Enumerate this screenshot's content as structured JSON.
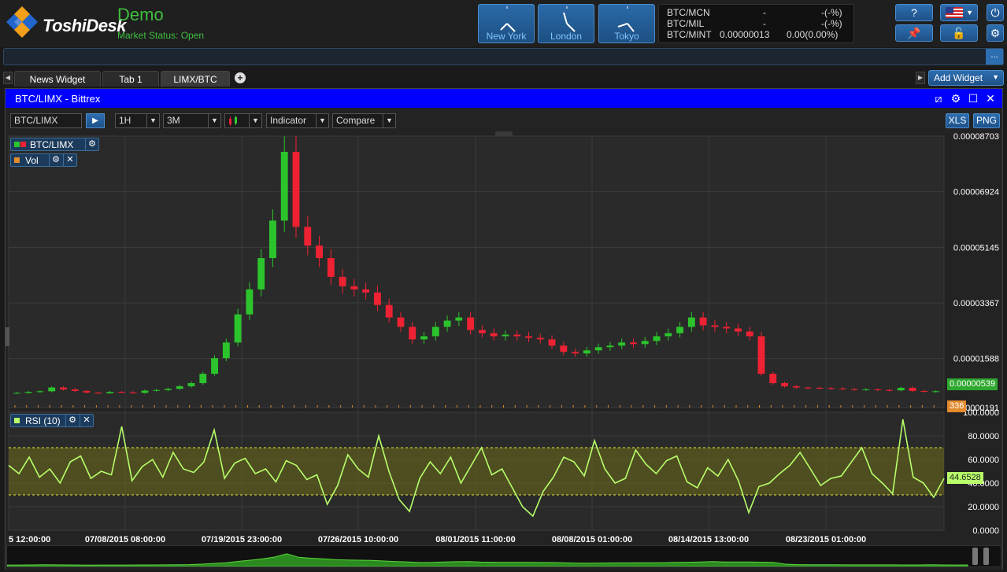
{
  "app": {
    "brand": "ToshiDesk",
    "mode": "Demo",
    "market_status": "Market Status: Open"
  },
  "clocks": [
    {
      "city": "New York"
    },
    {
      "city": "London"
    },
    {
      "city": "Tokyo"
    }
  ],
  "tickers": [
    {
      "symbol": "BTC/MCN",
      "price": "-",
      "change": "-(-%)"
    },
    {
      "symbol": "BTC/MIL",
      "price": "-",
      "change": "-(-%)"
    },
    {
      "symbol": "BTC/MINT",
      "price": "0.00000013",
      "change": "0.00(0.00%)"
    }
  ],
  "top_buttons": {
    "help": "?",
    "flag": "us-flag-icon",
    "pin": "pin-icon",
    "lock": "lock-icon",
    "power": "power-icon",
    "settings": "gear-icon"
  },
  "command_bar": {
    "more": "..."
  },
  "tabs": [
    {
      "label": "News Widget",
      "active": false
    },
    {
      "label": "Tab 1",
      "active": false
    },
    {
      "label": "LIMX/BTC",
      "active": true
    }
  ],
  "add_widget": "Add Widget",
  "widget": {
    "title": "BTC/LIMX - Bittrex",
    "symbol": "BTC/LIMX",
    "interval": "1H",
    "range": "3M",
    "indicator": "Indicator",
    "compare": "Compare",
    "xls": "XLS",
    "png": "PNG"
  },
  "legend": {
    "price": "BTC/LIMX",
    "vol": "Vol",
    "rsi": "RSI (10)"
  },
  "price_tag": "0.00000539",
  "vol_tag": "336",
  "rsi_tag": "44.6528",
  "chart_data": [
    {
      "type": "candlestick",
      "title": "BTC/LIMX",
      "y_ticks": [
        "0.00008703",
        "0.00006924",
        "0.00005145",
        "0.00003367",
        "0.00001588",
        "0.000000191"
      ],
      "ylim": [
        1.91e-07,
        8.703e-05
      ],
      "x_ticks": [
        "5 12:00:00",
        "07/08/2015 08:00:00",
        "07/19/2015 23:00:00",
        "07/26/2015 10:00:00",
        "08/01/2015 11:00:00",
        "08/08/2015 01:00:00",
        "08/14/2015 13:00:00",
        "08/23/2015 01:00:00"
      ],
      "close_series": [
        4.9e-06,
        5.2e-06,
        5.4e-06,
        6.6e-06,
        6e-06,
        5.5e-06,
        5e-06,
        4.8e-06,
        5.2e-06,
        5.1e-06,
        4.9e-06,
        5.6e-06,
        5.8e-06,
        6.2e-06,
        7e-06,
        8e-06,
        1.1e-05,
        1.6e-05,
        2.1e-05,
        3e-05,
        3.8e-05,
        4.8e-05,
        6e-05,
        8.2e-05,
        5.8e-05,
        5.2e-05,
        4.8e-05,
        4.2e-05,
        3.9e-05,
        3.8e-05,
        3.7e-05,
        3.3e-05,
        2.9e-05,
        2.6e-05,
        2.2e-05,
        2.3e-05,
        2.6e-05,
        2.8e-05,
        2.9e-05,
        2.5e-05,
        2.4e-05,
        2.3e-05,
        2.35e-05,
        2.3e-05,
        2.25e-05,
        2.2e-05,
        2e-05,
        1.8e-05,
        1.75e-05,
        1.85e-05,
        1.95e-05,
        2e-05,
        2.1e-05,
        2.05e-05,
        2.15e-05,
        2.3e-05,
        2.4e-05,
        2.6e-05,
        2.9e-05,
        2.65e-05,
        2.6e-05,
        2.55e-05,
        2.45e-05,
        2.3e-05,
        1.1e-05,
        8e-06,
        7e-06,
        6.6e-06,
        6.5e-06,
        6.4e-06,
        6.3e-06,
        6.1e-06,
        5.9e-06,
        6e-06,
        5.8e-06,
        5.7e-06,
        6.5e-06,
        5.5e-06,
        5.3e-06,
        5.4e-06
      ],
      "last_price": "0.00000539",
      "volume_last": "336"
    },
    {
      "type": "line",
      "title": "RSI (10)",
      "y_ticks": [
        "100.0000",
        "80.0000",
        "60.0000",
        "40.0000",
        "20.0000",
        "0.0000"
      ],
      "ylim": [
        0,
        100
      ],
      "bands": [
        30,
        70
      ],
      "values": [
        55,
        48,
        62,
        45,
        52,
        40,
        58,
        63,
        44,
        50,
        47,
        88,
        42,
        54,
        60,
        45,
        66,
        52,
        49,
        58,
        85,
        44,
        57,
        61,
        48,
        52,
        41,
        59,
        55,
        43,
        47,
        22,
        38,
        64,
        52,
        45,
        80,
        50,
        26,
        16,
        44,
        58,
        48,
        62,
        40,
        55,
        70,
        47,
        52,
        36,
        20,
        12,
        33,
        45,
        62,
        58,
        46,
        76,
        52,
        40,
        44,
        68,
        56,
        48,
        59,
        63,
        41,
        36,
        53,
        46,
        60,
        42,
        15,
        37,
        40,
        48,
        55,
        66,
        52,
        38,
        44,
        46,
        58,
        70,
        48,
        40,
        31,
        94,
        45,
        40,
        28,
        44
      ],
      "last_value": "44.6528"
    }
  ]
}
